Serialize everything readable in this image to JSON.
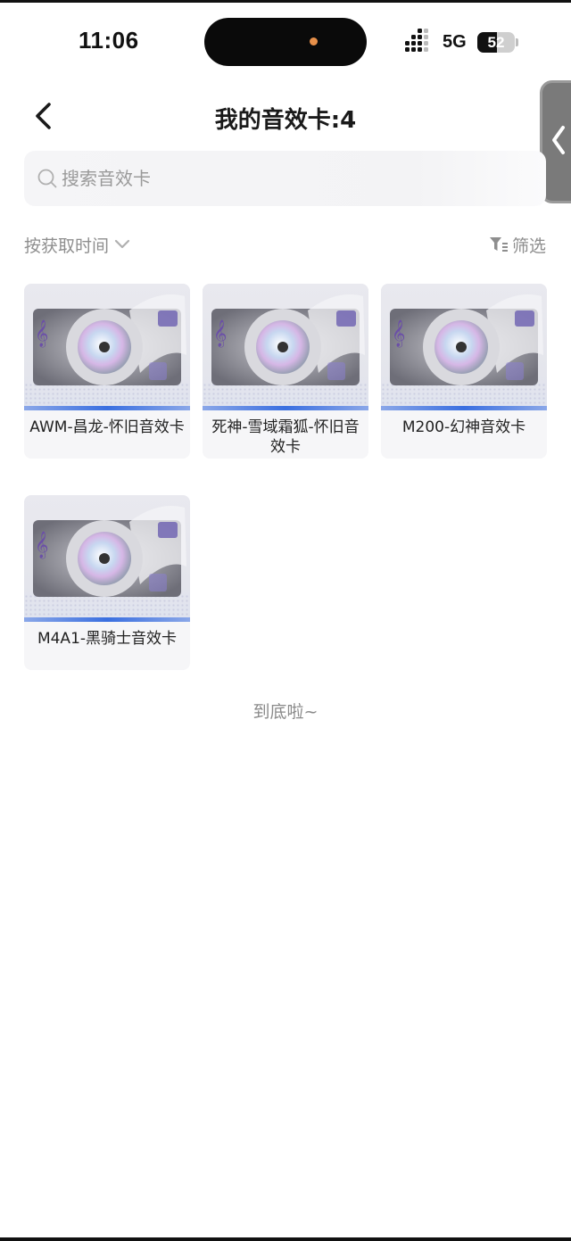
{
  "status_bar": {
    "time": "11:06",
    "network": "5G",
    "battery": "52",
    "battery_level": 0.52
  },
  "header": {
    "title": "我的音效卡:4"
  },
  "search": {
    "placeholder": "搜索音效卡",
    "value": ""
  },
  "toolbar": {
    "sort_label": "按获取时间",
    "filter_label": "筛选"
  },
  "cards": [
    {
      "name": "AWM-昌龙-怀旧音效卡"
    },
    {
      "name": "死神-雪域霜狐-怀旧音效卡"
    },
    {
      "name": "M200-幻神音效卡"
    },
    {
      "name": "M4A1-黑骑士音效卡"
    }
  ],
  "footer": {
    "end_text": "到底啦~"
  },
  "colors": {
    "accent_stripe": "#3a6fe0",
    "text_muted": "#8e8e8e"
  }
}
